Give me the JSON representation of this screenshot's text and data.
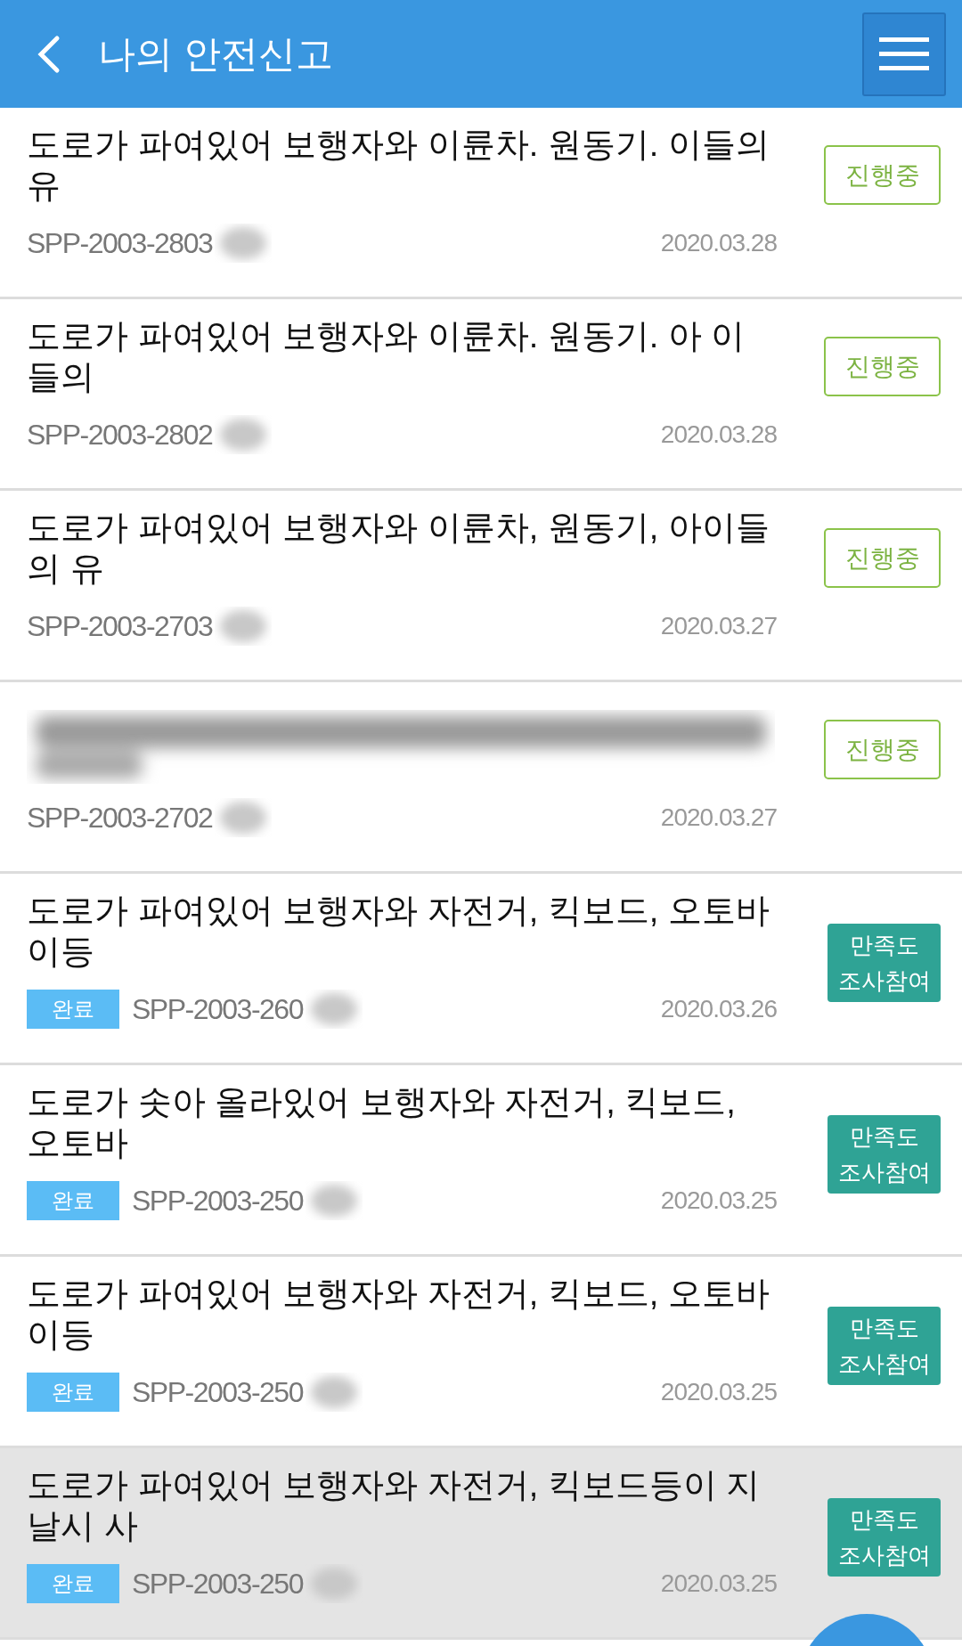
{
  "header": {
    "title": "나의 안전신고"
  },
  "reports": [
    {
      "title": "도로가 파여있어 보행자와 이륜차. 원동기. 이들의 유",
      "title_redacted": false,
      "id": "SPP-2003-2803",
      "id_redacted": true,
      "date": "2020.03.28",
      "action": {
        "kind": "status",
        "label": "진행중"
      },
      "selected": false
    },
    {
      "title": "도로가 파여있어 보행자와 이륜차. 원동기. 아 이들의",
      "title_redacted": false,
      "id": "SPP-2003-2802",
      "id_redacted": true,
      "date": "2020.03.28",
      "action": {
        "kind": "status",
        "label": "진행중"
      },
      "selected": false
    },
    {
      "title": "도로가 파여있어 보행자와 이륜차, 원동기, 아이들의 유",
      "title_redacted": false,
      "id": "SPP-2003-2703",
      "id_redacted": true,
      "date": "2020.03.27",
      "action": {
        "kind": "status",
        "label": "진행중"
      },
      "selected": false
    },
    {
      "title_redacted": true,
      "id": "SPP-2003-2702",
      "id_redacted": true,
      "date": "2020.03.27",
      "action": {
        "kind": "status",
        "label": "진행중"
      },
      "selected": false
    },
    {
      "title": "도로가 파여있어 보행자와 자전거, 킥보드, 오토바이등",
      "title_redacted": false,
      "id": "SPP-2003-260",
      "id_redacted": true,
      "done_badge": "완료",
      "date": "2020.03.26",
      "action": {
        "kind": "survey",
        "label": "만족도 조사참여"
      },
      "selected": false
    },
    {
      "title": "도로가 솟아 올라있어 보행자와 자전거, 킥보드, 오토바",
      "title_redacted": false,
      "id": "SPP-2003-250",
      "id_redacted": true,
      "done_badge": "완료",
      "date": "2020.03.25",
      "action": {
        "kind": "survey",
        "label": "만족도 조사참여"
      },
      "selected": false
    },
    {
      "title": "도로가 파여있어 보행자와 자전거, 킥보드, 오토바이등",
      "title_redacted": false,
      "id": "SPP-2003-250",
      "id_redacted": true,
      "done_badge": "완료",
      "date": "2020.03.25",
      "action": {
        "kind": "survey",
        "label": "만족도 조사참여"
      },
      "selected": false
    },
    {
      "title": "도로가 파여있어 보행자와 자전거, 킥보드등이 지날시 사",
      "title_redacted": false,
      "id": "SPP-2003-250",
      "id_redacted": true,
      "done_badge": "완료",
      "date": "2020.03.25",
      "action": {
        "kind": "survey",
        "label": "만족도 조사참여"
      },
      "selected": true
    }
  ]
}
